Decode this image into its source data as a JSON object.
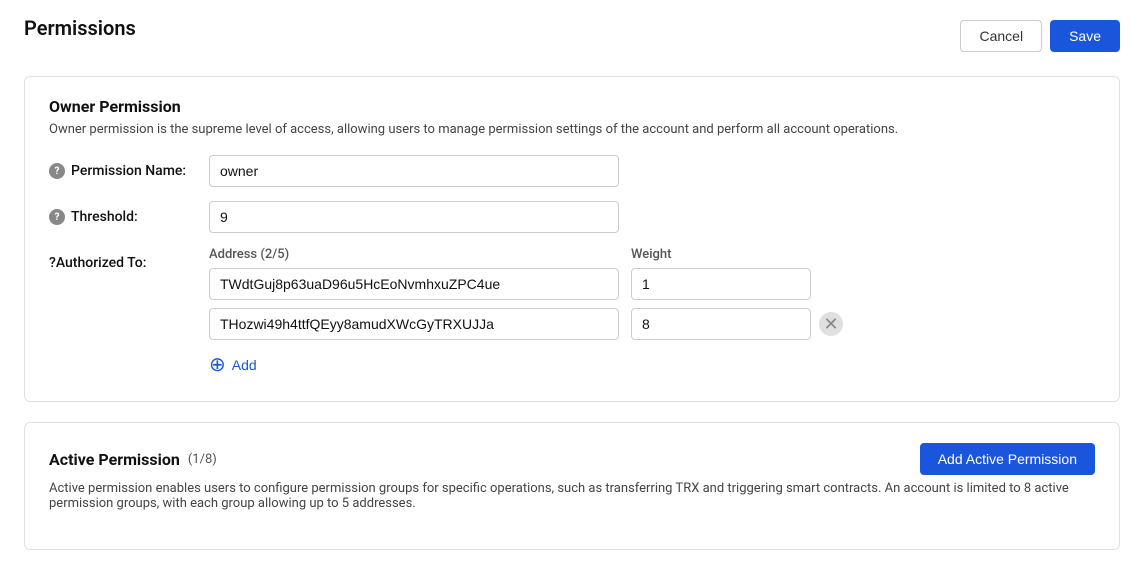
{
  "page": {
    "title": "Permissions"
  },
  "buttons": {
    "cancel_label": "Cancel",
    "save_label": "Save",
    "add_label": "Add",
    "add_active_permission_label": "Add Active Permission"
  },
  "owner_permission": {
    "heading": "Owner Permission",
    "description": "Owner permission is the supreme level of access, allowing users to manage permission settings of the account and perform all account operations.",
    "fields": {
      "permission_name": {
        "label": "Permission Name:",
        "value": "owner",
        "placeholder": "owner"
      },
      "threshold": {
        "label": "Threshold:",
        "value": "9",
        "placeholder": ""
      },
      "authorized_to": {
        "label": "Authorized To:",
        "address_col_header": "Address (2/5)",
        "weight_col_header": "Weight",
        "rows": [
          {
            "address": "TWdtGuj8p63uaD96u5HcEoNvmhxuZPC4ue",
            "weight": "1",
            "removable": false
          },
          {
            "address": "THozwi49h4ttfQEyy8amudXWcGyTRXUJJa",
            "weight": "8",
            "removable": true
          }
        ]
      }
    }
  },
  "active_permission": {
    "heading": "Active Permission",
    "badge": "(1/8)",
    "description": "Active permission enables users to configure permission groups for specific operations, such as transferring TRX and triggering smart contracts. An account is limited to 8 active permission groups, with each group allowing up to 5 addresses."
  },
  "help_icon_label": "?"
}
